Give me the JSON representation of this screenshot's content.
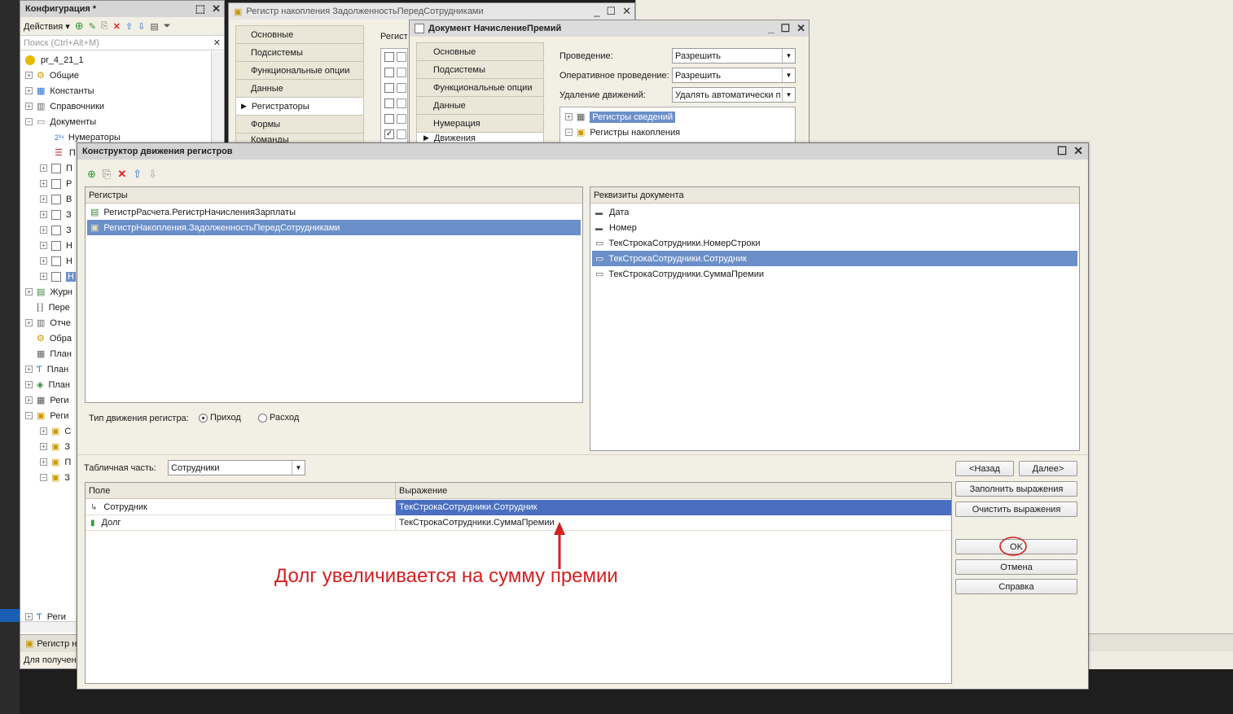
{
  "config_window": {
    "title": "Конфигурация *",
    "actions_label": "Действия",
    "search_placeholder": "Поиск (Ctrl+Alt+M)",
    "root": "pr_4_21_1",
    "items": [
      "Общие",
      "Константы",
      "Справочники",
      "Документы",
      "Нумераторы",
      "П",
      "П",
      "Р",
      "В",
      "З",
      "З",
      "Н",
      "Н",
      "Н",
      "Журн",
      "Пере",
      "Отче",
      "Обра",
      "План",
      "План",
      "План",
      "Реги",
      "Реги",
      "С",
      "З",
      "П",
      "З",
      "Реги"
    ],
    "bottom_tab": "Регистр н",
    "status": "Для получен"
  },
  "register_window": {
    "title": "Регистр накопления ЗадолженностьПередСотрудниками",
    "tabs": [
      "Основные",
      "Подсистемы",
      "Функциональные опции",
      "Данные",
      "Регистраторы",
      "Формы",
      "Команды"
    ],
    "content_label": "Регист"
  },
  "doc_window": {
    "title": "Документ НачислениеПремий",
    "tabs": [
      "Основные",
      "Подсистемы",
      "Функциональные опции",
      "Данные",
      "Нумерация",
      "Движения"
    ],
    "posting_label": "Проведение:",
    "posting_value": "Разрешить",
    "realtime_label": "Оперативное проведение:",
    "realtime_value": "Разрешить",
    "delete_label": "Удаление движений:",
    "delete_value": "Удалять автоматически п",
    "tree": [
      "Регистры сведений",
      "Регистры накопления"
    ]
  },
  "dialog": {
    "title": "Конструктор движения регистров",
    "registers_header": "Регистры",
    "registers": [
      "РегистрРасчета.РегистрНачисленияЗарплаты",
      "РегистрНакопления.ЗадолженностьПередСотрудниками"
    ],
    "doc_attrs_header": "Реквизиты документа",
    "doc_attrs": [
      "Дата",
      "Номер",
      "ТекСтрокаСотрудники.НомерСтроки",
      "ТекСтрокаСотрудники.Сотрудник",
      "ТекСтрокаСотрудники.СуммаПремии"
    ],
    "movement_type_label": "Тип движения регистра:",
    "income_label": "Приход",
    "expense_label": "Расход",
    "table_part_label": "Табличная часть:",
    "table_part_value": "Сотрудники",
    "col_field": "Поле",
    "col_expr": "Выражение",
    "rows": [
      {
        "field": "Сотрудник",
        "expr": "ТекСтрокаСотрудники.Сотрудник"
      },
      {
        "field": "Долг",
        "expr": "ТекСтрокаСотрудники.СуммаПремии"
      }
    ],
    "annotation": "Долг увеличивается на сумму премии",
    "btn_back": "<Назад",
    "btn_next": "Далее>",
    "btn_fill": "Заполнить выражения",
    "btn_clear": "Очистить выражения",
    "btn_ok": "OK",
    "btn_cancel": "Отмена",
    "btn_help": "Справка"
  },
  "colors": {
    "selection": "#6b8fc8",
    "annotation": "#d42020",
    "accent": "#3366cc"
  }
}
